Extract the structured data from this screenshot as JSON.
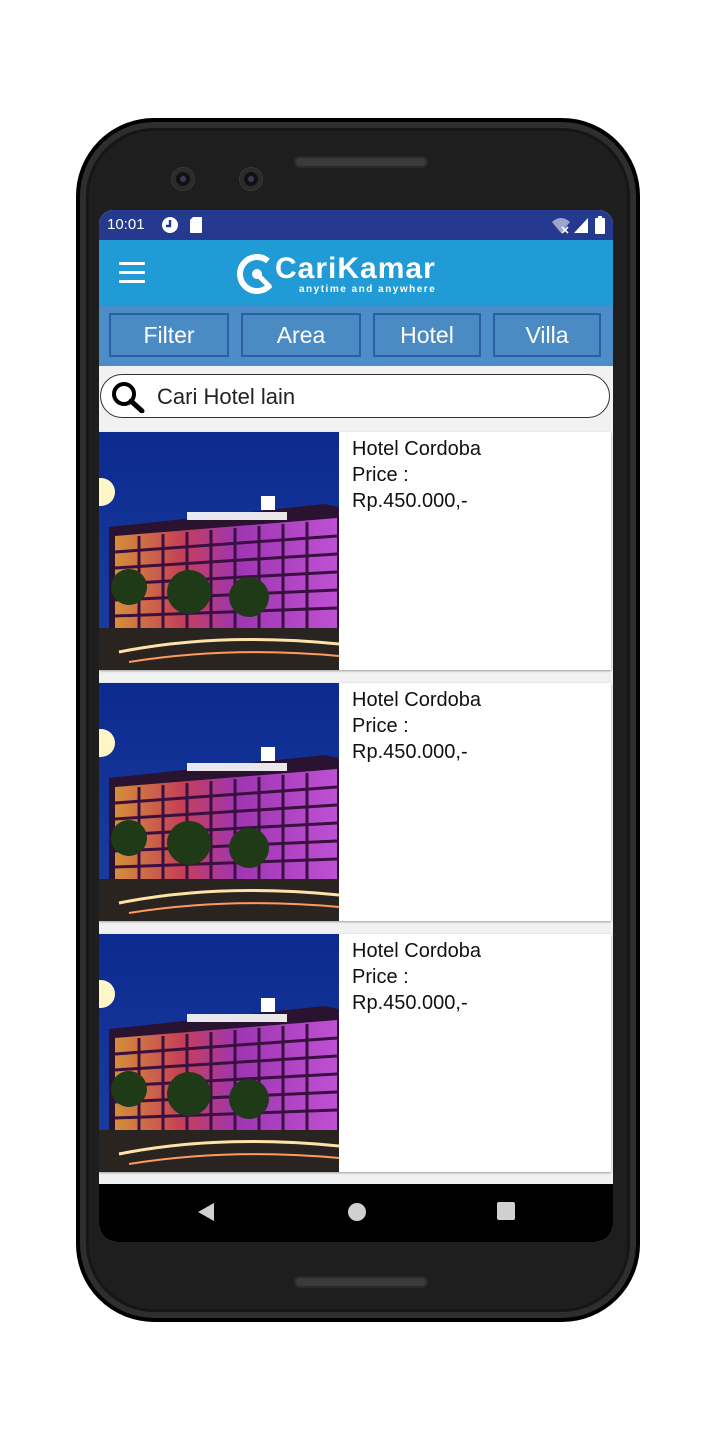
{
  "status_bar": {
    "time": "10:01",
    "icons": [
      "sync-icon",
      "sd-card-icon",
      "wifi-icon",
      "signal-icon",
      "battery-icon"
    ]
  },
  "app_bar": {
    "menu_icon": "hamburger-menu-icon",
    "logo_name": "CariKamar",
    "logo_tagline": "anytime and anywhere"
  },
  "tabs": [
    {
      "label": "Filter"
    },
    {
      "label": "Area"
    },
    {
      "label": "Hotel"
    },
    {
      "label": "Villa"
    }
  ],
  "search": {
    "icon": "search-icon",
    "placeholder": "Cari Hotel lain"
  },
  "listings": [
    {
      "name": "Hotel Cordoba",
      "price_label": "Price :",
      "price": "Rp.450.000,-"
    },
    {
      "name": "Hotel Cordoba",
      "price_label": "Price :",
      "price": "Rp.450.000,-"
    },
    {
      "name": "Hotel Cordoba",
      "price_label": "Price :",
      "price": "Rp.450.000,-"
    }
  ],
  "nav_bar": {
    "icons": [
      "back-icon",
      "home-icon",
      "recents-icon"
    ]
  },
  "colors": {
    "status_bar": "#253a8f",
    "app_bar": "#219bd6",
    "tab_bar": "#4d8dc7",
    "tab_border": "#2b5ea2"
  }
}
